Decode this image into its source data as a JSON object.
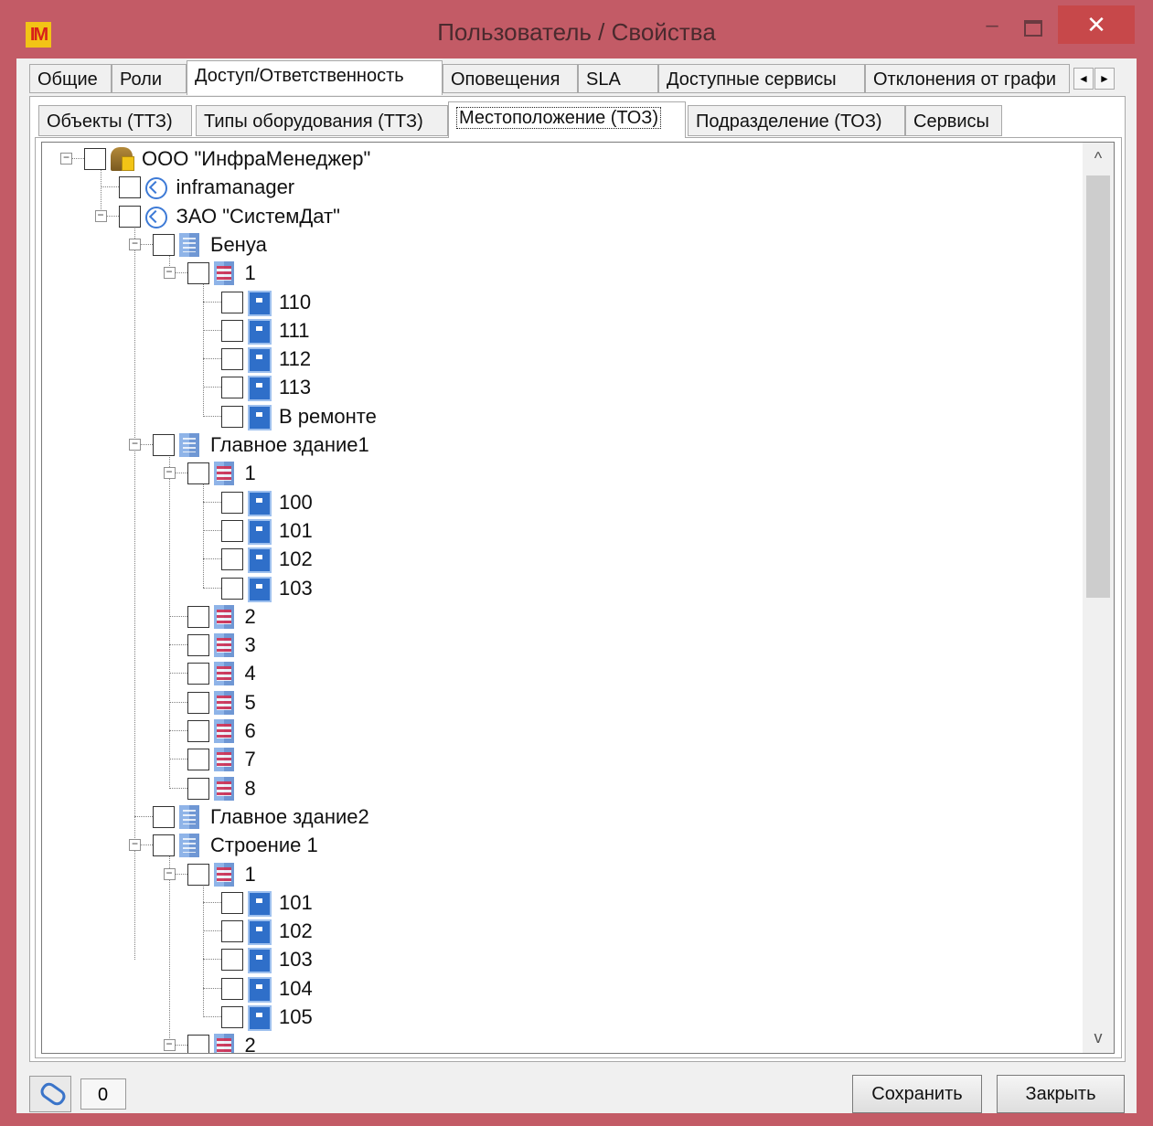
{
  "window": {
    "icon_text": "IM",
    "title": "Пользователь / Свойства",
    "minimize": "–",
    "close": "✕"
  },
  "tabs_main": [
    {
      "label": "Общие",
      "active": false
    },
    {
      "label": "Роли",
      "active": false
    },
    {
      "label": "Доступ/Ответственность",
      "active": true
    },
    {
      "label": "Оповещения",
      "active": false
    },
    {
      "label": "SLA",
      "active": false
    },
    {
      "label": "Доступные сервисы",
      "active": false
    },
    {
      "label": "Отклонения от графи",
      "active": false
    }
  ],
  "tab_arrows": {
    "left": "◄",
    "right": "►"
  },
  "tabs_sub": [
    {
      "label": "Объекты (ТТЗ)",
      "active": false
    },
    {
      "label": "Типы оборудования (ТТЗ)",
      "active": false
    },
    {
      "label": "Местоположение (ТОЗ)",
      "active": true
    },
    {
      "label": "Подразделение (ТОЗ)",
      "active": false
    },
    {
      "label": "Сервисы",
      "active": false
    }
  ],
  "tree": {
    "nodes": [
      {
        "label": "ООО \"ИнфраМенеджер\"",
        "icon": "organization-icon",
        "level": 0,
        "expanded": true
      },
      {
        "label": "inframanager",
        "icon": "network-icon",
        "level": 1,
        "expanded": null
      },
      {
        "label": "ЗАО \"СистемДат\"",
        "icon": "network-icon",
        "level": 1,
        "expanded": true
      },
      {
        "label": "Бенуа",
        "icon": "building-icon",
        "level": 2,
        "expanded": true
      },
      {
        "label": "1",
        "icon": "floor-icon",
        "level": 3,
        "expanded": true
      },
      {
        "label": "110",
        "icon": "room-icon",
        "level": 4,
        "expanded": null
      },
      {
        "label": "111",
        "icon": "room-icon",
        "level": 4,
        "expanded": null
      },
      {
        "label": "112",
        "icon": "room-icon",
        "level": 4,
        "expanded": null
      },
      {
        "label": "113",
        "icon": "room-icon",
        "level": 4,
        "expanded": null
      },
      {
        "label": "В ремонте",
        "icon": "room-icon",
        "level": 4,
        "expanded": null
      },
      {
        "label": "Главное здание1",
        "icon": "building-icon",
        "level": 2,
        "expanded": true
      },
      {
        "label": "1",
        "icon": "floor-icon",
        "level": 3,
        "expanded": true
      },
      {
        "label": "100",
        "icon": "room-icon",
        "level": 4,
        "expanded": null
      },
      {
        "label": "101",
        "icon": "room-icon",
        "level": 4,
        "expanded": null
      },
      {
        "label": "102",
        "icon": "room-icon",
        "level": 4,
        "expanded": null
      },
      {
        "label": "103",
        "icon": "room-icon",
        "level": 4,
        "expanded": null
      },
      {
        "label": "2",
        "icon": "floor-icon",
        "level": 3,
        "expanded": null
      },
      {
        "label": "3",
        "icon": "floor-icon",
        "level": 3,
        "expanded": null
      },
      {
        "label": "4",
        "icon": "floor-icon",
        "level": 3,
        "expanded": null
      },
      {
        "label": "5",
        "icon": "floor-icon",
        "level": 3,
        "expanded": null
      },
      {
        "label": "6",
        "icon": "floor-icon",
        "level": 3,
        "expanded": null
      },
      {
        "label": "7",
        "icon": "floor-icon",
        "level": 3,
        "expanded": null
      },
      {
        "label": "8",
        "icon": "floor-icon",
        "level": 3,
        "expanded": null
      },
      {
        "label": "Главное здание2",
        "icon": "building-icon",
        "level": 2,
        "expanded": null
      },
      {
        "label": "Строение 1",
        "icon": "building-icon",
        "level": 2,
        "expanded": true
      },
      {
        "label": "1",
        "icon": "floor-icon",
        "level": 3,
        "expanded": true
      },
      {
        "label": "101",
        "icon": "room-icon",
        "level": 4,
        "expanded": null
      },
      {
        "label": "102",
        "icon": "room-icon",
        "level": 4,
        "expanded": null
      },
      {
        "label": "103",
        "icon": "room-icon",
        "level": 4,
        "expanded": null
      },
      {
        "label": "104",
        "icon": "room-icon",
        "level": 4,
        "expanded": null
      },
      {
        "label": "105",
        "icon": "room-icon",
        "level": 4,
        "expanded": null
      },
      {
        "label": "2",
        "icon": "floor-icon",
        "level": 3,
        "expanded": true
      }
    ]
  },
  "scrollbar": {
    "up": "^",
    "down": "v"
  },
  "footer": {
    "attachment_icon": "paperclip-icon",
    "attachment_count": "0",
    "save_label": "Сохранить",
    "close_label": "Закрыть"
  },
  "colors": {
    "frame": "#c35b66",
    "close_button": "#c7484a",
    "accent_icon": "#2f6fc9"
  }
}
